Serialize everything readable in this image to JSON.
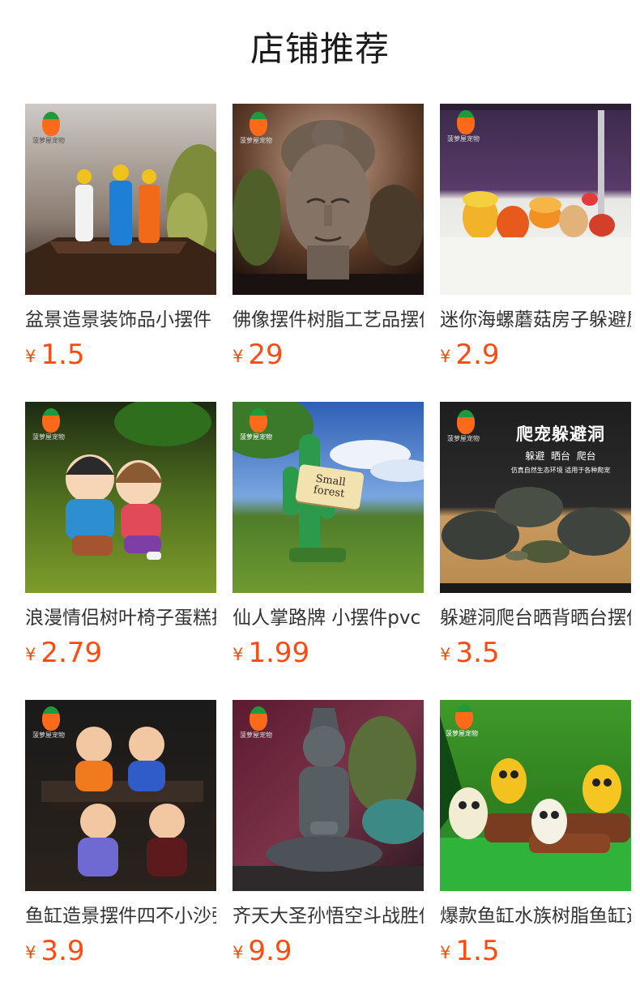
{
  "shop": {
    "title": "店铺推荐"
  },
  "products": [
    {
      "name": "盆景造景装饰品小摆件",
      "currency": "¥",
      "price": "1.5",
      "image": "figurines-on-wood-stand",
      "logo_text": "菠萝屋宠物"
    },
    {
      "name": "佛像摆件树脂工艺品摆件",
      "currency": "¥",
      "price": "29",
      "image": "buddha-head",
      "logo_text": "菠萝屋宠物"
    },
    {
      "name": "迷你海螺蘑菇房子躲避屋",
      "currency": "¥",
      "price": "2.9",
      "image": "mushroom-shell-houses",
      "logo_text": "菠萝屋宠物"
    },
    {
      "name": "浪漫情侣树叶椅子蛋糕摆件",
      "currency": "¥",
      "price": "2.79",
      "image": "couple-figurines",
      "logo_text": "菠萝屋宠物"
    },
    {
      "name": "仙人掌路牌 小摆件pvc",
      "currency": "¥",
      "price": "1.99",
      "image": "cactus-signpost",
      "logo_text": "菠萝屋宠物",
      "sign_text": "Small forest"
    },
    {
      "name": "躲避洞爬台晒背晒台摆件",
      "currency": "¥",
      "price": "3.5",
      "image": "reptile-hide-cave",
      "logo_text": "菠萝屋宠物",
      "banner": {
        "title": "爬宠躲避洞",
        "subtitle": "躲避  晒台  爬台",
        "caption": "仿真自然生态环境 适用于各种爬宠"
      }
    },
    {
      "name": "鱼缸造景摆件四不小沙弥",
      "currency": "¥",
      "price": "3.9",
      "image": "four-little-monks",
      "logo_text": "菠萝屋宠物"
    },
    {
      "name": "齐天大圣孙悟空斗战胜佛",
      "currency": "¥",
      "price": "9.9",
      "image": "monkey-king-statue",
      "logo_text": "菠萝屋宠物"
    },
    {
      "name": "爆款鱼缸水族树脂鱼缸造景",
      "currency": "¥",
      "price": "1.5",
      "image": "owls-on-logs",
      "logo_text": "菠萝屋宠物"
    }
  ],
  "colors": {
    "price": "#ff4a12",
    "title": "#1a1a1a",
    "name": "#333333"
  }
}
